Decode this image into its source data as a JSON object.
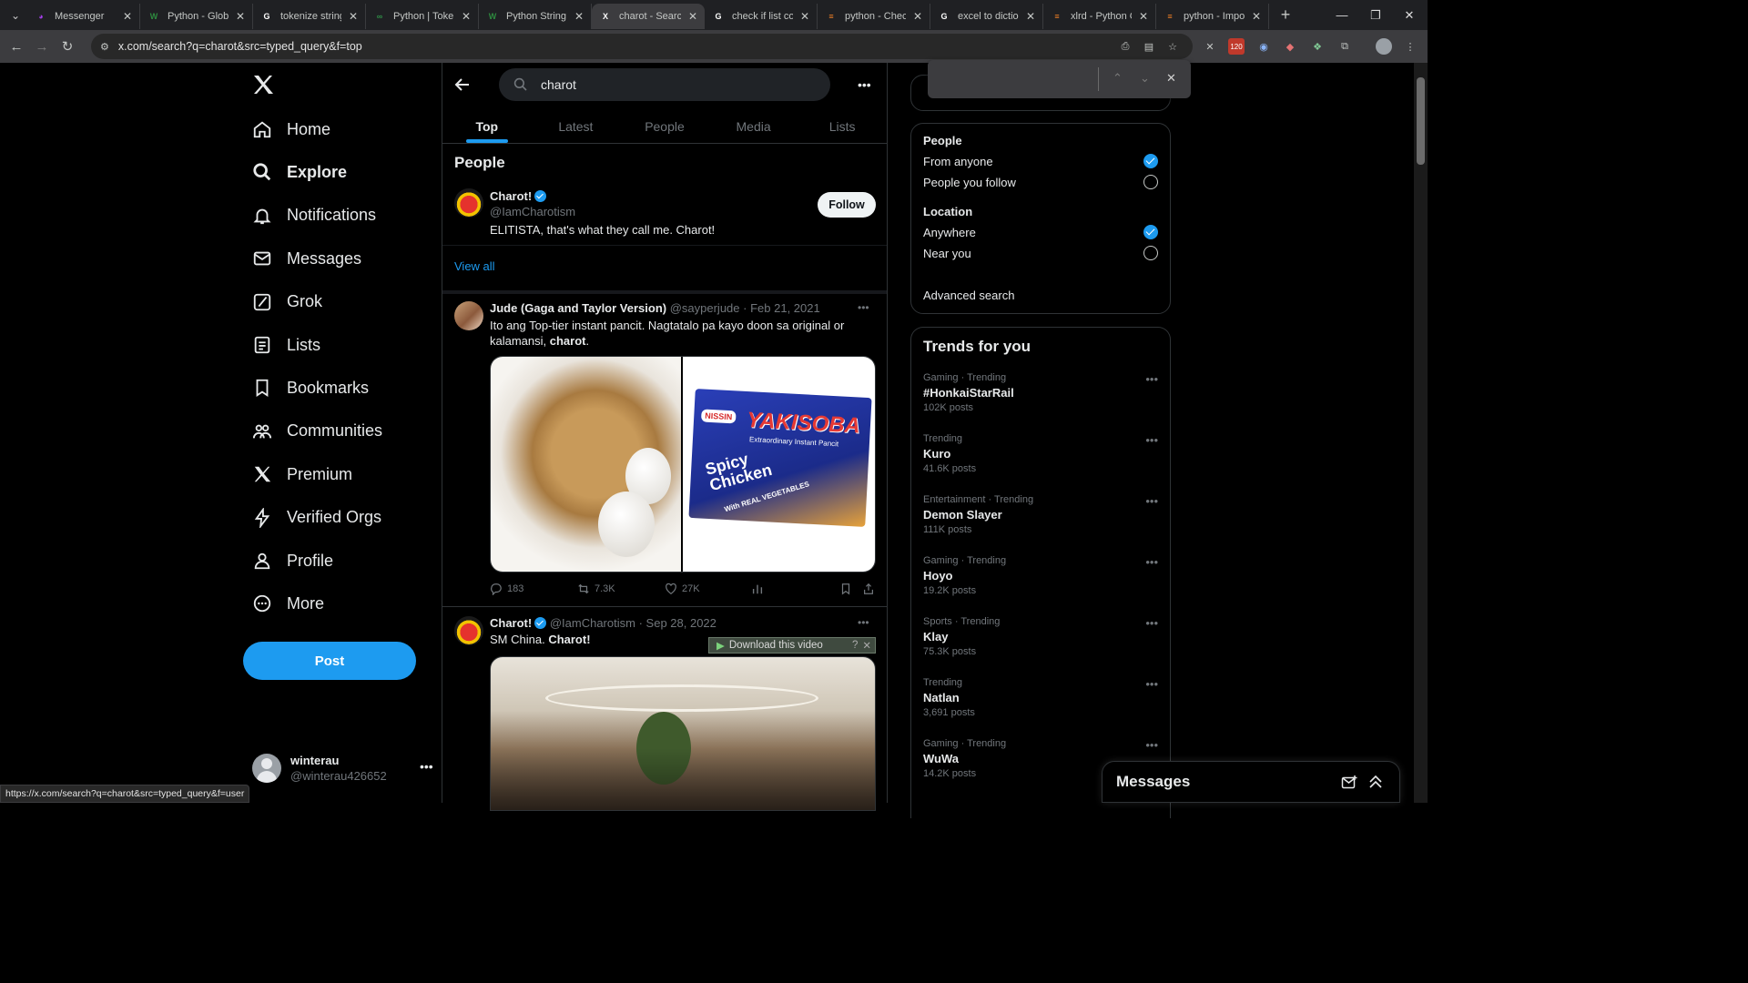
{
  "browser": {
    "tabs": [
      {
        "title": "Messenger",
        "fav": "messenger-icon",
        "color": "#a33ee8"
      },
      {
        "title": "Python - Globa",
        "fav": "w-icon",
        "color": "#2d8a3e"
      },
      {
        "title": "tokenize string",
        "fav": "google-icon",
        "color": "#ffffff"
      },
      {
        "title": "Python | Token",
        "fav": "gfg-icon",
        "color": "#2f8d46"
      },
      {
        "title": "Python String s",
        "fav": "w-icon",
        "color": "#2d8a3e"
      },
      {
        "title": "charot - Search",
        "fav": "x-icon",
        "color": "#ffffff"
      },
      {
        "title": "check if list con",
        "fav": "google-icon",
        "color": "#ffffff"
      },
      {
        "title": "python - Check",
        "fav": "stackoverflow-icon",
        "color": "#f48024"
      },
      {
        "title": "excel to diction",
        "fav": "google-icon",
        "color": "#ffffff"
      },
      {
        "title": "xlrd - Python C",
        "fav": "stackoverflow-icon",
        "color": "#f48024"
      },
      {
        "title": "python - Impo",
        "fav": "stackoverflow-icon",
        "color": "#f48024"
      }
    ],
    "url": "x.com/search?q=charot&src=typed_query&f=top",
    "ext_badge": "120",
    "status_url": "https://x.com/search?q=charot&src=typed_query&f=user"
  },
  "nav": {
    "items": [
      "Home",
      "Explore",
      "Notifications",
      "Messages",
      "Grok",
      "Lists",
      "Bookmarks",
      "Communities",
      "Premium",
      "Verified Orgs",
      "Profile",
      "More"
    ],
    "post": "Post",
    "account_name": "winterau",
    "account_handle": "@winterau426652"
  },
  "search": {
    "query": "charot",
    "tabs": [
      "Top",
      "Latest",
      "People",
      "Media",
      "Lists"
    ]
  },
  "people": {
    "title": "People",
    "name": "Charot!",
    "handle": "@IamCharotism",
    "bio": "ELITISTA, that's what they call me. Charot!",
    "follow": "Follow",
    "view_all": "View all"
  },
  "tweet1": {
    "name": "Jude (Gaga and Taylor Version)",
    "handle": "@sayperjude",
    "date": "Feb 21, 2021",
    "text_a": "Ito ang Top-tier instant pancit. Nagtatalo pa kayo doon sa original or kalamansi, ",
    "text_b": "charot",
    "text_c": ".",
    "replies": "183",
    "retweets": "7.3K",
    "likes": "27K",
    "pack_brand": "NISSIN",
    "pack_title": "YAKISOBA",
    "pack_sub": "Extraordinary Instant Pancit",
    "pack_flavor": "Spicy Chicken",
    "pack_veg": "With REAL VEGETABLES"
  },
  "tweet2": {
    "name": "Charot!",
    "handle": "@IamCharotism",
    "date": "Sep 28, 2022",
    "text_a": "SM China. ",
    "text_b": "Charot!",
    "download": "Download this video"
  },
  "filters": {
    "people_h": "People",
    "from_anyone": "From anyone",
    "people_follow": "People you follow",
    "location_h": "Location",
    "anywhere": "Anywhere",
    "near_you": "Near you",
    "advanced": "Advanced search"
  },
  "trends": {
    "title": "Trends for you",
    "items": [
      {
        "ctx": "Gaming · Trending",
        "name": "#HonkaiStarRail",
        "count": "102K posts"
      },
      {
        "ctx": "Trending",
        "name": "Kuro",
        "count": "41.6K posts"
      },
      {
        "ctx": "Entertainment · Trending",
        "name": "Demon Slayer",
        "count": "111K posts"
      },
      {
        "ctx": "Gaming · Trending",
        "name": "Hoyo",
        "count": "19.2K posts"
      },
      {
        "ctx": "Sports · Trending",
        "name": "Klay",
        "count": "75.3K posts"
      },
      {
        "ctx": "Trending",
        "name": "Natlan",
        "count": "3,691 posts"
      },
      {
        "ctx": "Gaming · Trending",
        "name": "WuWa",
        "count": "14.2K posts"
      }
    ]
  },
  "messages": {
    "title": "Messages"
  },
  "colors": {
    "accent": "#1d9bf0",
    "bg": "#000000",
    "border": "#2f3336",
    "muted": "#71767b"
  }
}
